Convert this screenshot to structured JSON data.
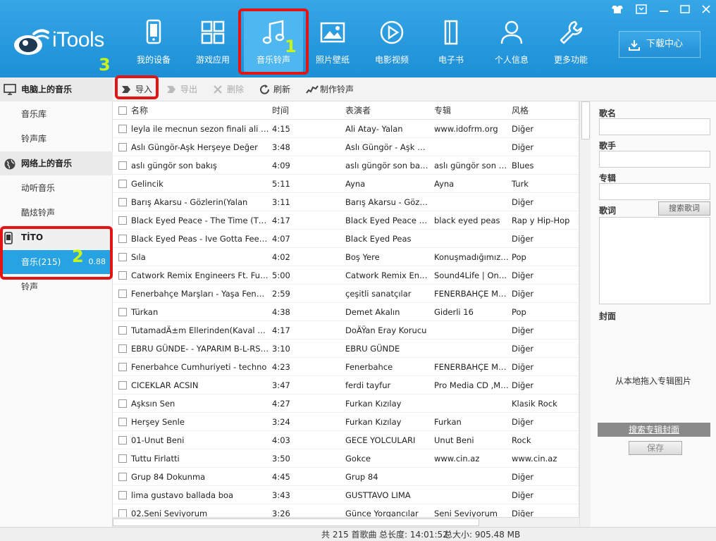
{
  "app": {
    "brand": "iTools"
  },
  "nav": [
    {
      "label": "我的设备",
      "icon": "device-icon"
    },
    {
      "label": "游戏应用",
      "icon": "apps-grid-icon"
    },
    {
      "label": "音乐铃声",
      "icon": "music-note-icon",
      "active": true
    },
    {
      "label": "照片壁纸",
      "icon": "photo-icon"
    },
    {
      "label": "电影视频",
      "icon": "play-icon"
    },
    {
      "label": "电子书",
      "icon": "book-icon"
    },
    {
      "label": "个人信息",
      "icon": "person-icon"
    },
    {
      "label": "更多功能",
      "icon": "wrench-icon"
    }
  ],
  "download_center": "下载中心",
  "annotations": {
    "a1": "1",
    "a2": "2",
    "a3": "3"
  },
  "sidebar": {
    "pc_music": {
      "title": "电脑上的音乐",
      "items": [
        "音乐库",
        "铃声库"
      ]
    },
    "online_music": {
      "title": "网络上的音乐",
      "items": [
        "动听音乐",
        "酷炫铃声"
      ]
    },
    "device": {
      "title": "TİTO",
      "music": "音乐(215)",
      "music_size": "0.88",
      "ringtones": "铃声"
    }
  },
  "toolbar": {
    "import": "导入",
    "export": "导出",
    "delete": "删除",
    "refresh": "刷新",
    "make_ringtone": "制作铃声"
  },
  "table": {
    "headers": [
      "名称",
      "时间",
      "表演者",
      "专辑",
      "风格"
    ],
    "rows": [
      [
        "leyla ile mecnun sezon finali ali ata...",
        "4:15",
        "Ali Atay- Yalan",
        "www.idofrm.org",
        "Diğer"
      ],
      [
        "Aslı Güngör-Aşk Herşeye Değer",
        "3:48",
        "Aslı Güngör - Aşk He...",
        "",
        "Diğer"
      ],
      [
        "aslı güngör son bakış",
        "4:09",
        "aslı güngör son bakış",
        "aslı güngör son ba...",
        "Blues"
      ],
      [
        "Gelincik",
        "5:11",
        "Ayna",
        "Ayna",
        "Turk"
      ],
      [
        "Barış Akarsu - Gözlerin(Yalan",
        "3:11",
        "Barış Akarsu - Gözleri...",
        "",
        "Diğer"
      ],
      [
        "Black Eyed Peace - The Time (The ...",
        "4:17",
        "Black Eyed Peace - T...",
        "black eyed peas",
        "Rap y Hip-Hop"
      ],
      [
        "Black Eyed Peas - Ive Gotta Feeling ...",
        "4:07",
        "Black Eyed Peas",
        "",
        "Diğer"
      ],
      [
        "Sıla",
        "4:02",
        "Boş Yere",
        "Konuşmadığımız ...",
        "Pop"
      ],
      [
        "Catwork Remix Engineers Ft. Funda...",
        "5:00",
        "Catwork Remix Engin...",
        "Sound4Life | Only ...",
        "Diğer"
      ],
      [
        "Fenerbahçe Marşları - Yaşa Fenerb...",
        "2:59",
        "çeşitli sanatçılar",
        "FENERBAHÇE MA...",
        "Diğer"
      ],
      [
        "Türkan",
        "4:38",
        "Demet Akalın",
        "Giderli 16",
        "Pop"
      ],
      [
        " TutamadÄ±m Ellerinden(Kaval ver...",
        "4:17",
        "DoÄŸan Eray Korucu",
        "",
        "Diğer"
      ],
      [
        "EBRU GÜNDE- - YAPARIM B-L-RS-N",
        "3:10",
        "EBRU GÜNDE",
        "",
        "Diğer"
      ],
      [
        "Fenerbahce Cumhuriyeti - techno",
        "4:23",
        " Fenerbahce",
        "FENERBAHÇE MA...",
        "Diğer"
      ],
      [
        "CICEKLAR ACSIN",
        "3:47",
        "ferdi tayfur",
        "Pro Media CD ,Mü...",
        "Diğer"
      ],
      [
        "Aşksın Sen",
        "4:27",
        "Furkan Kızılay",
        "",
        "Klasik Rock"
      ],
      [
        "Herşey Senle",
        "3:24",
        "Furkan Kızılay",
        "Furkan",
        "Diğer"
      ],
      [
        "01-Unut Beni",
        "4:03",
        "GECE YOLCULARI",
        "Unut Beni",
        "Rock"
      ],
      [
        "Tuttu Firlatti",
        "3:50",
        "Gokce",
        "www.cin.az",
        "www.cin.az"
      ],
      [
        "Grup 84 Dokunma",
        "4:45",
        "Grup 84",
        "",
        "Diğer"
      ],
      [
        "lima gustavo ballada boa",
        "3:43",
        "GUSTTAVO LIMA",
        "",
        "Diğer"
      ],
      [
        "02.Seni Seviyorum",
        "3:26",
        "Günce Yorgancılar",
        "Seni Seviyorum",
        "Diğer"
      ]
    ]
  },
  "right_panel": {
    "song_name": "歌名",
    "artist": "歌手",
    "album": "专辑",
    "lyrics": "歌词",
    "search_lyrics": "搜索歌词",
    "cover": "封面",
    "cover_drop": "从本地拖入专辑图片",
    "search_cover": "搜索专辑封面",
    "save": "保存"
  },
  "status": {
    "total": "共 215 首歌曲",
    "duration": "总长度: 14:01:52",
    "size": "总大小: 905.48 MB"
  },
  "colors": {
    "header": "#1d8fd6",
    "active_nav": "#4fb7f0",
    "active_sidebar": "#27a2e2",
    "annotation_box": "#e31414",
    "annotation_digit": "#c6f51e"
  }
}
